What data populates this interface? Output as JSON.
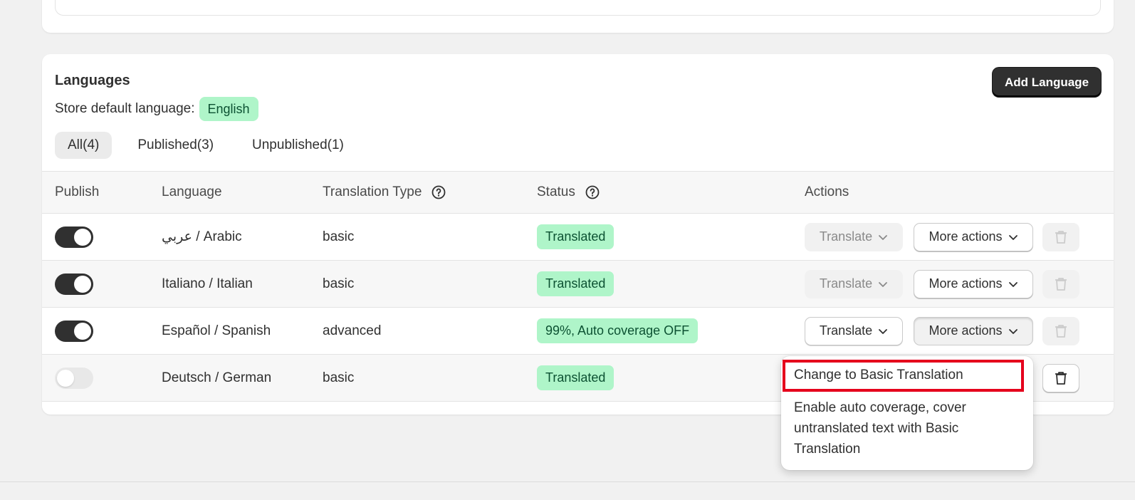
{
  "section": {
    "title": "Languages",
    "default_label": "Store default language:",
    "default_value": "English",
    "add_button": "Add Language"
  },
  "tabs": [
    {
      "label": "All(4)",
      "active": true
    },
    {
      "label": "Published(3)",
      "active": false
    },
    {
      "label": "Unpublished(1)",
      "active": false
    }
  ],
  "table": {
    "headers": {
      "publish": "Publish",
      "language": "Language",
      "translation_type": "Translation Type",
      "status": "Status",
      "actions": "Actions"
    },
    "rows": [
      {
        "published": true,
        "language": "عربي / Arabic",
        "type": "basic",
        "status": "Translated",
        "translate_label": "Translate",
        "translate_enabled": false,
        "more_label": "More actions",
        "delete_enabled": false
      },
      {
        "published": true,
        "language": "Italiano / Italian",
        "type": "basic",
        "status": "Translated",
        "translate_label": "Translate",
        "translate_enabled": false,
        "more_label": "More actions",
        "delete_enabled": false
      },
      {
        "published": true,
        "language": "Español / Spanish",
        "type": "advanced",
        "status": "99%, Auto coverage OFF",
        "translate_label": "Translate",
        "translate_enabled": true,
        "more_label": "More actions",
        "delete_enabled": false
      },
      {
        "published": false,
        "language": "Deutsch / German",
        "type": "basic",
        "status": "Translated",
        "delete_enabled": true
      }
    ]
  },
  "dropdown": {
    "items": [
      "Change to Basic Translation",
      "Enable auto coverage, cover untranslated text with Basic Translation"
    ]
  },
  "icons": {
    "help": "question-circle-icon",
    "chevron": "chevron-down-icon",
    "delete": "trash-icon"
  },
  "colors": {
    "badge_bg": "#aff5c9",
    "badge_text": "#0c5132",
    "primary_button": "#303030",
    "highlight": "#e5001c"
  }
}
